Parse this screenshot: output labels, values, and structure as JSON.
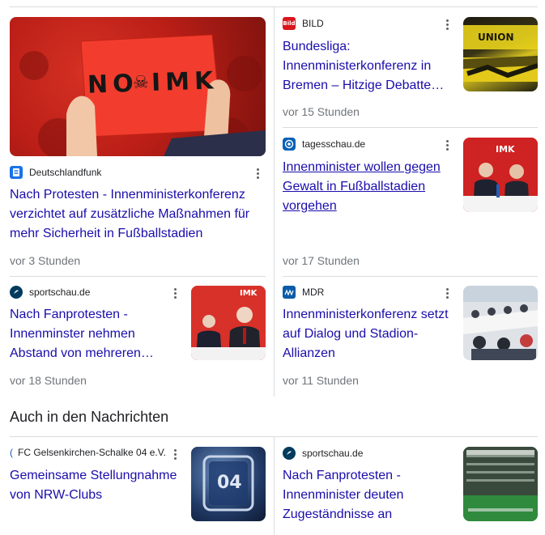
{
  "cards": [
    {
      "source": "Deutschlandfunk",
      "title": "Nach Protesten - Innenministerkonferenz verzichtet auf zusätzliche Maßnahmen für mehr Sicherheit in Fußballstadien",
      "time": "vor 3 Stunden",
      "image_text": "NO IMK",
      "image_icon": "skull-icon"
    },
    {
      "source": "BILD",
      "title": "Bundesliga: Innenministerkonferenz in Bremen – Hitzige Debatte u…",
      "time": "vor 15 Stunden",
      "favicon_text": "Bild",
      "image_text": "UNION"
    },
    {
      "source": "tagesschau.de",
      "title": "Innenminister wollen gegen Gewalt in Fußballstadien vorgehen",
      "time": "vor 17 Stunden",
      "image_text": "IMK"
    },
    {
      "source": "sportschau.de",
      "title": "Nach Fanprotesten - Innenminster nehmen Abstand von mehreren…",
      "time": "vor 18 Stunden",
      "image_text": "IMK"
    },
    {
      "source": "MDR",
      "title": "Innenministerkonferenz setzt auf Dialog und Stadion-Allianzen",
      "time": "vor 11 Stunden"
    }
  ],
  "section_heading": "Auch in den Nachrichten",
  "news": [
    {
      "source": "FC Gelsenkirchen-Schalke 04 e.V.",
      "title": "Gemeinsame Stellungnahme von NRW-Clubs",
      "image_text": "04"
    },
    {
      "source": "sportschau.de",
      "title": "Nach Fanprotesten - Innenminister deuten Zugeständnisse an"
    }
  ],
  "colors": {
    "link": "#1a0dab",
    "meta": "#70757a",
    "divider": "#dadce0",
    "bild_red": "#d8161b",
    "tagesschau_blue": "#0a60b6",
    "dlf_blue": "#1a73e8",
    "sportschau_navy": "#003a5d",
    "mdr_blue": "#0b5ca8"
  }
}
